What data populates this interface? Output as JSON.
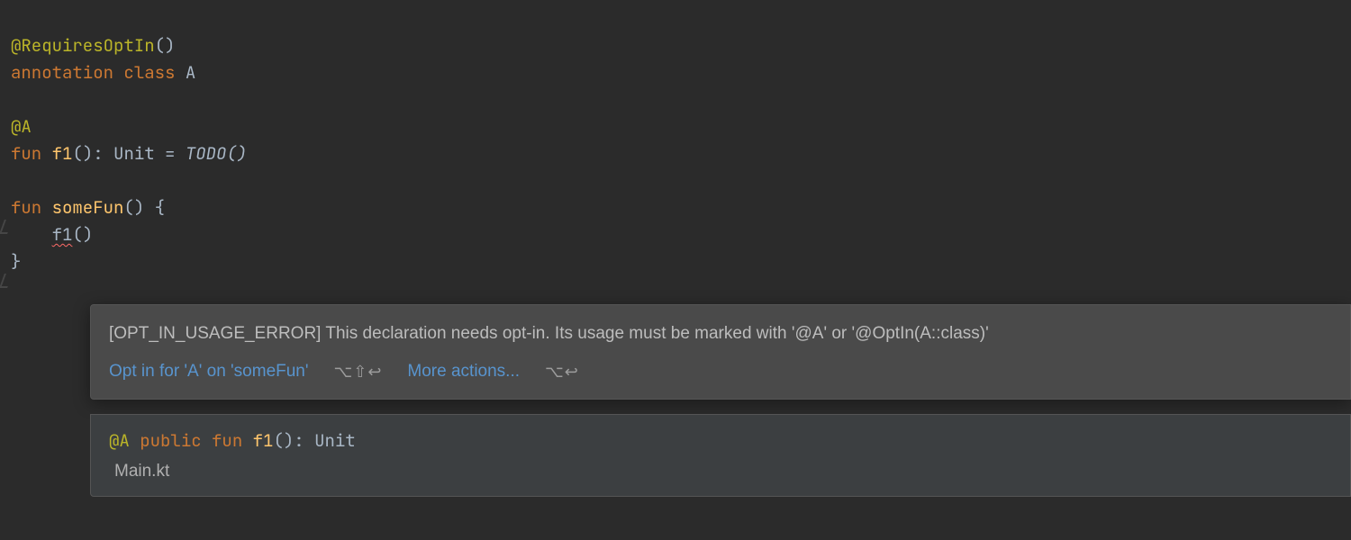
{
  "code": {
    "l1": {
      "ann": "@RequiresOptIn",
      "paren": "()"
    },
    "l2": {
      "kw1": "annotation",
      "kw2": "class",
      "name": "A"
    },
    "l4": {
      "ann": "@A"
    },
    "l5": {
      "kw": "fun",
      "name": "f1",
      "paren": "()",
      "colon": ": ",
      "type": "Unit",
      "eq": " = ",
      "todo": "TODO",
      "todoParen": "()"
    },
    "l7": {
      "kw": "fun",
      "name": "someFun",
      "paren": "()",
      "brace": " {"
    },
    "l8": {
      "indent": "    ",
      "call": "f1",
      "paren": "()"
    },
    "l9": {
      "brace": "}"
    }
  },
  "tooltip": {
    "message": "[OPT_IN_USAGE_ERROR] This declaration needs opt-in. Its usage must be marked with '@A' or '@OptIn(A::class)'",
    "action1": "Opt in for 'A' on 'someFun'",
    "shortcut1": "⌥⇧↩",
    "action2": "More actions...",
    "shortcut2": "⌥↩"
  },
  "doc": {
    "ann": "@A",
    "kw1": "public",
    "kw2": "fun",
    "name": "f1",
    "paren": "()",
    "colon": ": ",
    "type": "Unit",
    "file": "Main.kt"
  }
}
